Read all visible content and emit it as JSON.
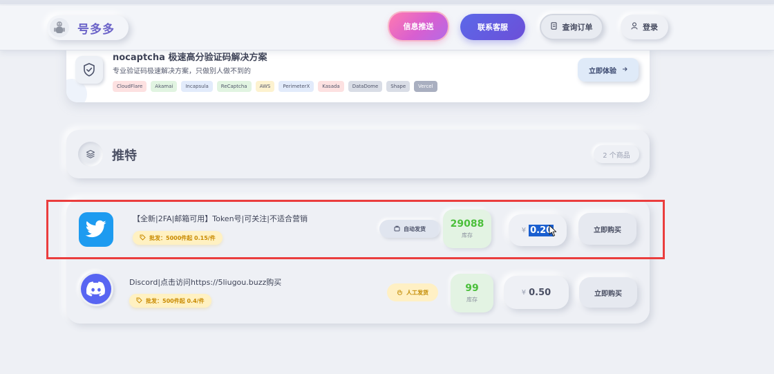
{
  "header": {
    "brand": "号多多",
    "buttons": {
      "push": "信息推送",
      "service": "联系客服",
      "query": "查询订单",
      "login": "登录"
    }
  },
  "nocaptcha": {
    "title": "nocaptcha 极速高分验证码解决方案",
    "description": "专业验证码极速解决方案，只做别人做不到的",
    "tags": [
      "CloudFlare",
      "Akamai",
      "Incapsula",
      "ReCaptcha",
      "AWS",
      "PerimeterX",
      "Kasada",
      "DataDome",
      "Shape",
      "Vercel"
    ],
    "try_button": "立即体验"
  },
  "category": {
    "title": "推特",
    "count": "2 个商品"
  },
  "products": [
    {
      "name": "【全新|2FA|邮箱可用】Token号|可关注|不适合营销",
      "wholesale": "批发：5000件起 0.15/件",
      "shipping": "自动发货",
      "stock": "29088",
      "stock_label": "库存",
      "currency": "¥",
      "price": "0.20",
      "buy": "立即购买"
    },
    {
      "name": "Discord|点击访问https://5liugou.buzz购买",
      "wholesale": "批发：500件起 0.4/件",
      "shipping": "人工发货",
      "stock": "99",
      "stock_label": "库存",
      "currency": "¥",
      "price": "0.50",
      "buy": "立即购买"
    }
  ],
  "colors": {
    "accent_purple": "#6b63c8",
    "push_gradient_start": "#ff7ab0",
    "service_blue": "#5b68e8",
    "twitter_blue": "#1d9bf0",
    "discord_blurple": "#5865f2",
    "stock_green": "#4bbf3b",
    "highlight_red": "#ea3d3d"
  },
  "icons": {
    "logo": "mascot-icon",
    "shield": "shield-check-icon",
    "layers": "layers-icon",
    "twitter": "twitter-bird-icon",
    "discord": "discord-icon"
  }
}
